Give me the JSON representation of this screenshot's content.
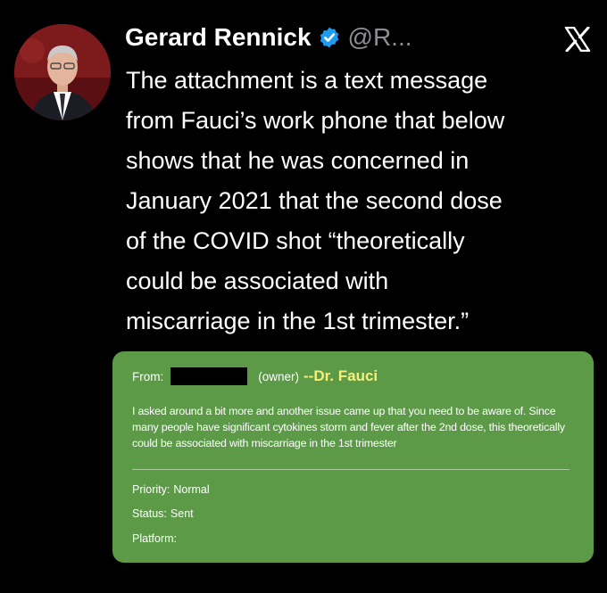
{
  "tweet": {
    "author_name": "Gerard Rennick",
    "handle": "@R...",
    "text": "The attachment is a text message\nfrom Fauci’s work phone that below\nshows that he was concerned in\nJanuary 2021 that the second dose\nof the COVID shot “theoretically\ncould be associated with\nmiscarriage in the 1st trimester.”"
  },
  "icons": {
    "verified": "verified-badge-icon",
    "platform_logo": "x-logo-icon"
  },
  "message_card": {
    "from_label": "From:",
    "owner_label": "(owner)",
    "sender": "--Dr. Fauci",
    "body": "I asked around a bit more and another issue came up that you need to be aware of.  Since\nmany people have significant cytokines storm and  fever after the 2nd dose, this theoretically\ncould be associated with miscarriage in the 1st trimester",
    "priority_label": "Priority:",
    "priority_value": "Normal",
    "status_label": "Status:",
    "status_value": "Sent",
    "platform_label": "Platform:"
  },
  "colors": {
    "background": "#000000",
    "card": "#5c9a48",
    "sender_highlight": "#f4f07a",
    "verified_blue": "#1d9bf0",
    "handle_grey": "#8b8f94"
  }
}
